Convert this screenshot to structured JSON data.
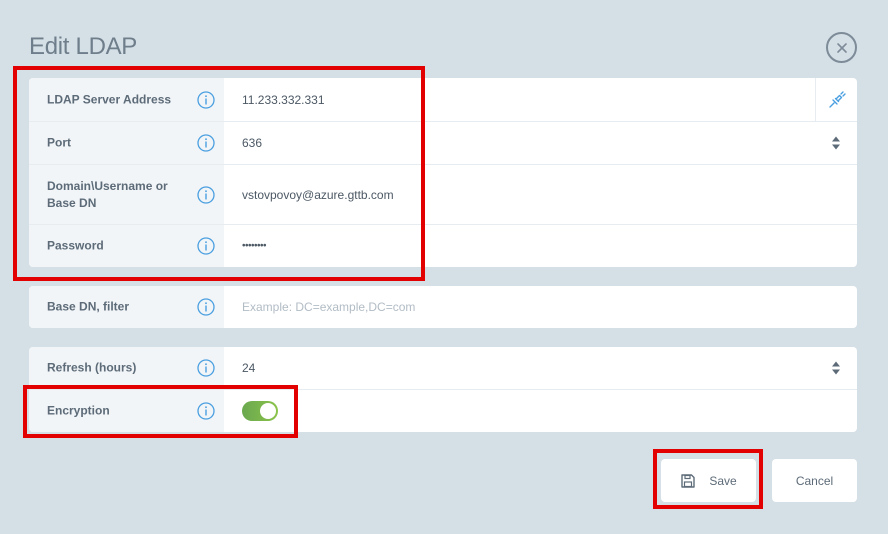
{
  "dialog": {
    "title": "Edit LDAP"
  },
  "connection_fields": [
    {
      "label": "LDAP Server Address",
      "value": "11.233.332.331"
    },
    {
      "label": "Port",
      "value": "636"
    },
    {
      "label": "Domain\\Username or Base DN",
      "value": "vstovpovoy@azure.gttb.com"
    },
    {
      "label": "Password",
      "value": "••••••••"
    }
  ],
  "base_dn": {
    "label": "Base DN, filter",
    "placeholder": "Example: DC=example,DC=com"
  },
  "settings_fields": {
    "refresh": {
      "label": "Refresh (hours)",
      "value": "24"
    },
    "encryption": {
      "label": "Encryption",
      "enabled": true
    }
  },
  "buttons": {
    "save": "Save",
    "cancel": "Cancel"
  },
  "colors": {
    "background": "#d5dfe6",
    "label_background": "#f1f5f8",
    "info_icon": "#4a9fe0",
    "toggle_on": "#7cb342",
    "highlight": "#e30000"
  }
}
